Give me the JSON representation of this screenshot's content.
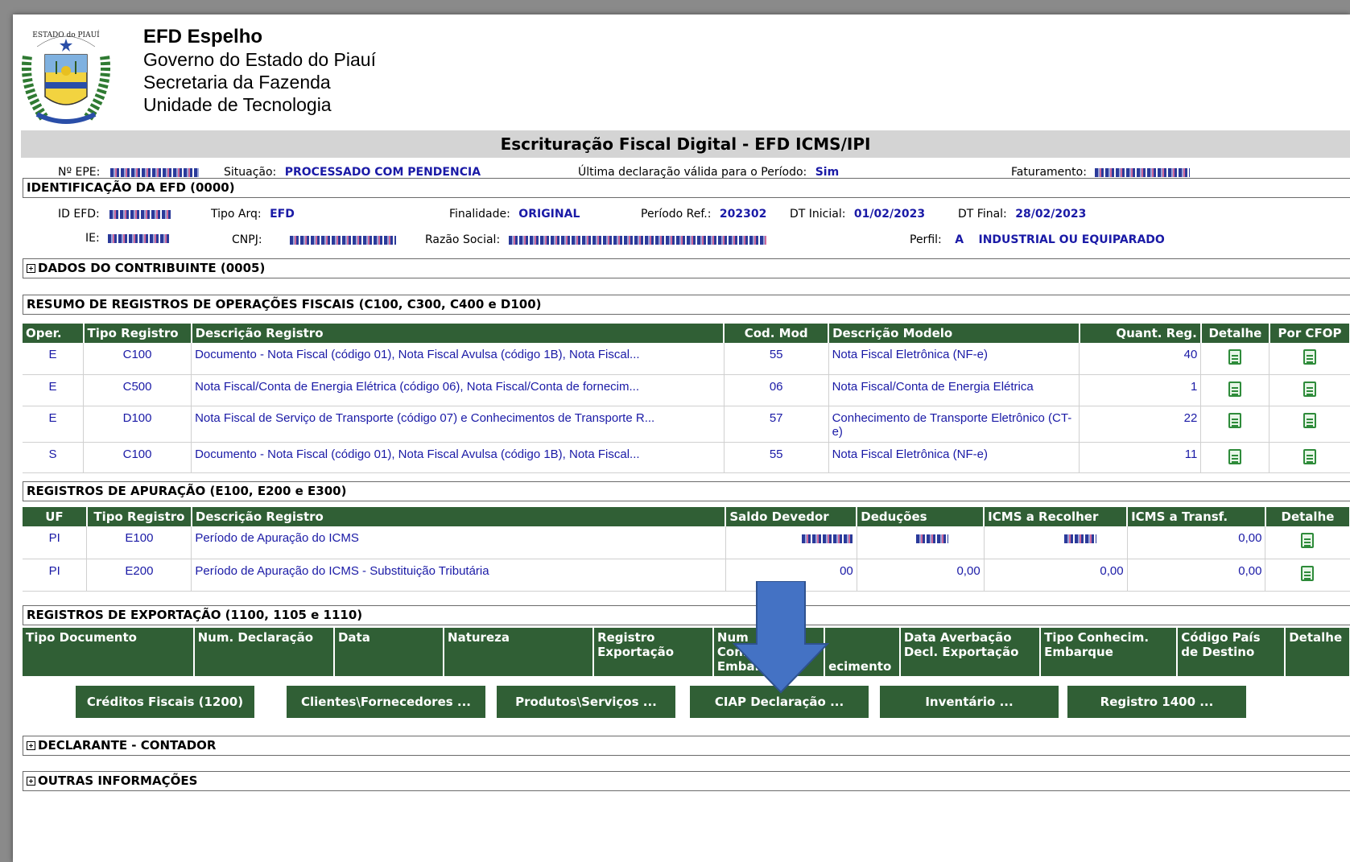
{
  "header": {
    "app_title": "EFD Espelho",
    "org_lines": [
      "Governo do Estado do Piauí",
      "Secretaria da Fazenda",
      "Unidade de Tecnologia"
    ],
    "logo_text": "ESTADO do PIAUÍ"
  },
  "main_title": "Escrituração Fiscal Digital - EFD ICMS/IPI",
  "status": {
    "epe_label": "Nº EPE:",
    "situacao_label": "Situação:",
    "situacao_value": "PROCESSADO COM PENDENCIA",
    "ultima_label": "Última declaração válida para o Período:",
    "ultima_value": "Sim",
    "faturamento_label": "Faturamento:"
  },
  "identificacao": {
    "section_title": "IDENTIFICAÇÃO DA EFD (0000)",
    "id_efd_label": "ID EFD:",
    "tipo_arq_label": "Tipo Arq:",
    "tipo_arq_value": "EFD",
    "finalidade_label": "Finalidade:",
    "finalidade_value": "ORIGINAL",
    "periodo_label": "Período Ref.:",
    "periodo_value": "202302",
    "dt_inicial_label": "DT Inicial:",
    "dt_inicial_value": "01/02/2023",
    "dt_final_label": "DT Final:",
    "dt_final_value": "28/02/2023",
    "ie_label": "IE:",
    "cnpj_label": "CNPJ:",
    "razao_label": "Razão Social:",
    "perfil_label": "Perfil:",
    "perfil_code": "A",
    "perfil_value": "INDUSTRIAL OU EQUIPARADO"
  },
  "dados_contribuinte": "DADOS DO CONTRIBUINTE (0005)",
  "resumo": {
    "section_title": "RESUMO DE REGISTROS DE OPERAÇÕES FISCAIS (C100, C300, C400 e D100)",
    "headers": [
      "Oper.",
      "Tipo Registro",
      "Descrição Registro",
      "Cod. Mod",
      "Descrição Modelo",
      "Quant. Reg.",
      "Detalhe",
      "Por CFOP"
    ],
    "rows": [
      {
        "oper": "E",
        "tipo": "C100",
        "desc": "Documento - Nota Fiscal (código 01), Nota Fiscal Avulsa (código 1B), Nota Fiscal...",
        "cod": "55",
        "modelo": "Nota Fiscal Eletrônica (NF-e)",
        "quant": "40"
      },
      {
        "oper": "E",
        "tipo": "C500",
        "desc": "Nota Fiscal/Conta de Energia Elétrica (código 06), Nota Fiscal/Conta de fornecim...",
        "cod": "06",
        "modelo": "Nota Fiscal/Conta de Energia Elétrica",
        "quant": "1"
      },
      {
        "oper": "E",
        "tipo": "D100",
        "desc": "Nota Fiscal de Serviço de Transporte (código 07) e Conhecimentos de Transporte R...",
        "cod": "57",
        "modelo": "Conhecimento de Transporte Eletrônico (CT-e)",
        "quant": "22"
      },
      {
        "oper": "S",
        "tipo": "C100",
        "desc": "Documento - Nota Fiscal (código 01), Nota Fiscal Avulsa (código 1B), Nota Fiscal...",
        "cod": "55",
        "modelo": "Nota Fiscal Eletrônica (NF-e)",
        "quant": "11"
      }
    ]
  },
  "apuracao": {
    "section_title": "REGISTROS DE APURAÇÃO (E100, E200 e E300)",
    "headers": [
      "UF",
      "Tipo Registro",
      "Descrição Registro",
      "Saldo Devedor",
      "Deduções",
      "ICMS a Recolher",
      "ICMS a Transf.",
      "Detalhe"
    ],
    "rows": [
      {
        "uf": "PI",
        "tipo": "E100",
        "desc": "Período de Apuração do ICMS",
        "saldo": "",
        "deducoes": "",
        "recolher": "",
        "transf": "0,00"
      },
      {
        "uf": "PI",
        "tipo": "E200",
        "desc": "Período de Apuração do ICMS - Substituição Tributária",
        "saldo": "00",
        "deducoes": "0,00",
        "recolher": "0,00",
        "transf": "0,00"
      }
    ]
  },
  "exportacao": {
    "section_title": "REGISTROS DE EXPORTAÇÃO (1100, 1105 e 1110)",
    "headers": [
      "Tipo Documento",
      "Num. Declaração",
      "Data",
      "Natureza",
      "Registro Exportação",
      "Num Conhecimen Embarque",
      "ecimento",
      "Data Averbação Decl. Exportação",
      "Tipo Conhecim. Embarque",
      "Código País de Destino",
      "Detalhe"
    ]
  },
  "buttons": [
    "Créditos Fiscais (1200)",
    "Clientes\\Fornecedores ...",
    "Produtos\\Serviços ...",
    "CIAP Declaração ...",
    "Inventário ...",
    "Registro 1400 ..."
  ],
  "declarante": "DECLARANTE - CONTADOR",
  "outras": "OUTRAS INFORMAÇÕES",
  "colors": {
    "header_green": "#305f35",
    "value_blue": "#1a1aa6",
    "arrow_blue": "#4472c4",
    "icon_green": "#2e8b3a"
  }
}
